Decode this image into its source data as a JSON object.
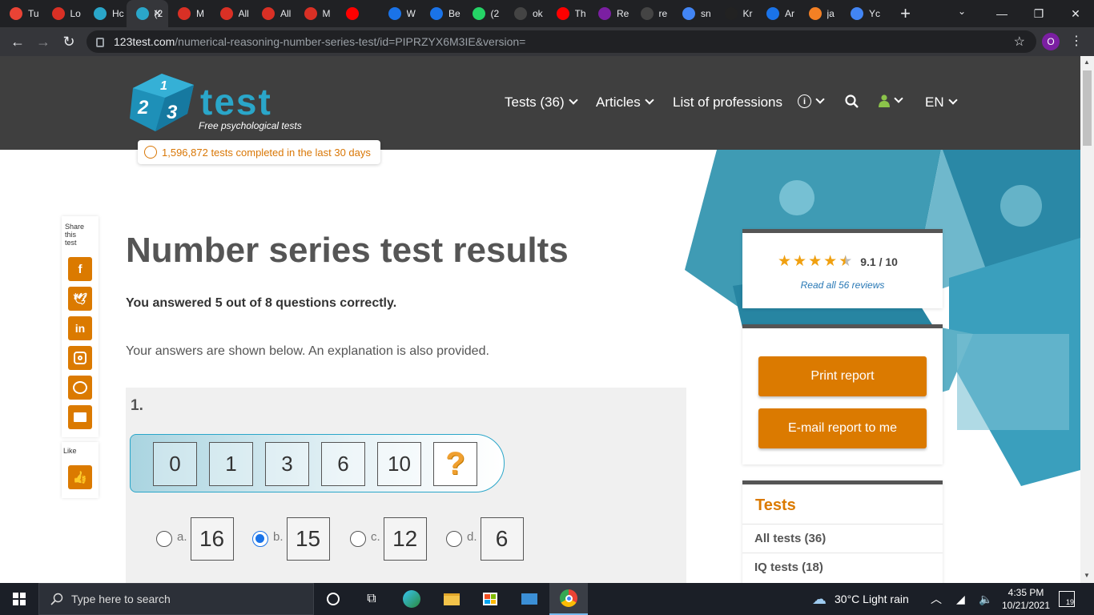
{
  "browser": {
    "tabs": [
      {
        "title": "Tu",
        "icon": "gmail-icon",
        "color": "#ea4335"
      },
      {
        "title": "Lo",
        "icon": "tunga-icon",
        "color": "#d93025"
      },
      {
        "title": "Hc",
        "icon": "cube-icon",
        "color": "#2aa6c9"
      },
      {
        "title": "(2",
        "icon": "cube-icon",
        "color": "#2aa6c9",
        "active": true
      },
      {
        "title": "M",
        "icon": "tunga-icon",
        "color": "#d93025"
      },
      {
        "title": "All",
        "icon": "tunga-icon",
        "color": "#d93025"
      },
      {
        "title": "All",
        "icon": "tunga-icon",
        "color": "#d93025"
      },
      {
        "title": "M",
        "icon": "tunga-icon",
        "color": "#d93025"
      },
      {
        "title": "",
        "icon": "youtube-icon",
        "color": "#ff0000"
      },
      {
        "title": "W",
        "icon": "info-icon",
        "color": "#1a73e8"
      },
      {
        "title": "Be",
        "icon": "info-icon",
        "color": "#1a73e8"
      },
      {
        "title": "(2",
        "icon": "whatsapp-icon",
        "color": "#25d366"
      },
      {
        "title": "ok",
        "icon": "github-icon",
        "color": "#444"
      },
      {
        "title": "Th",
        "icon": "youtube-icon",
        "color": "#ff0000"
      },
      {
        "title": "Re",
        "icon": "upwork-icon",
        "color": "#7b1fa2"
      },
      {
        "title": "re",
        "icon": "github-icon",
        "color": "#444"
      },
      {
        "title": "sn",
        "icon": "google-icon",
        "color": "#4285f4"
      },
      {
        "title": "Kr",
        "icon": "a-icon",
        "color": "#222"
      },
      {
        "title": "Ar",
        "icon": "chat-icon",
        "color": "#1a73e8"
      },
      {
        "title": "ja",
        "icon": "stack-icon",
        "color": "#f48024"
      },
      {
        "title": "Yc",
        "icon": "google-icon",
        "color": "#4285f4"
      }
    ],
    "url_host": "123test.com",
    "url_path": "/numerical-reasoning-number-series-test/id=PIPRZYX6M3IE&version=",
    "profile_initial": "O"
  },
  "site": {
    "logo_text": "test",
    "logo_cube_digits": [
      "1",
      "2",
      "3"
    ],
    "tagline": "Free psychological tests",
    "nav": {
      "tests": "Tests (36)",
      "articles": "Articles",
      "professions": "List of professions",
      "lang": "EN"
    },
    "counter_text": "1,596,872 tests completed in the last 30 days",
    "accent_color": "#db7a00",
    "brand_color": "#2aa6c9"
  },
  "share": {
    "title": "Share this test",
    "like_label": "Like",
    "buttons": [
      {
        "name": "facebook",
        "glyph": "f"
      },
      {
        "name": "twitter",
        "glyph": "🐦"
      },
      {
        "name": "linkedin",
        "glyph": "in"
      },
      {
        "name": "instagram",
        "glyph": "◎"
      },
      {
        "name": "messenger",
        "glyph": "⌁"
      },
      {
        "name": "email",
        "glyph": "✉"
      }
    ]
  },
  "main": {
    "title": "Number series test results",
    "score_text": "You answered 5 out of 8 questions correctly.",
    "explain_text": "Your answers are shown below. An explanation is also provided.",
    "question": {
      "number": "1.",
      "sequence": [
        "0",
        "1",
        "3",
        "6",
        "10"
      ],
      "unknown": "?",
      "options": [
        {
          "letter": "a.",
          "value": "16",
          "selected": false
        },
        {
          "letter": "b.",
          "value": "15",
          "selected": true
        },
        {
          "letter": "c.",
          "value": "12",
          "selected": false
        },
        {
          "letter": "d.",
          "value": "6",
          "selected": false
        }
      ]
    }
  },
  "sidebar": {
    "rating_value": "9.1 / 10",
    "rating_stars": 4.5,
    "reviews_link": "Read all 56 reviews",
    "print_button": "Print report",
    "email_button": "E-mail report to me",
    "tests_title": "Tests",
    "tests_items": [
      "All tests (36)",
      "IQ tests (18)"
    ]
  },
  "taskbar": {
    "search_placeholder": "Type here to search",
    "weather": "30°C  Light rain",
    "time": "4:35 PM",
    "date": "10/21/2021",
    "notifications": "19"
  }
}
